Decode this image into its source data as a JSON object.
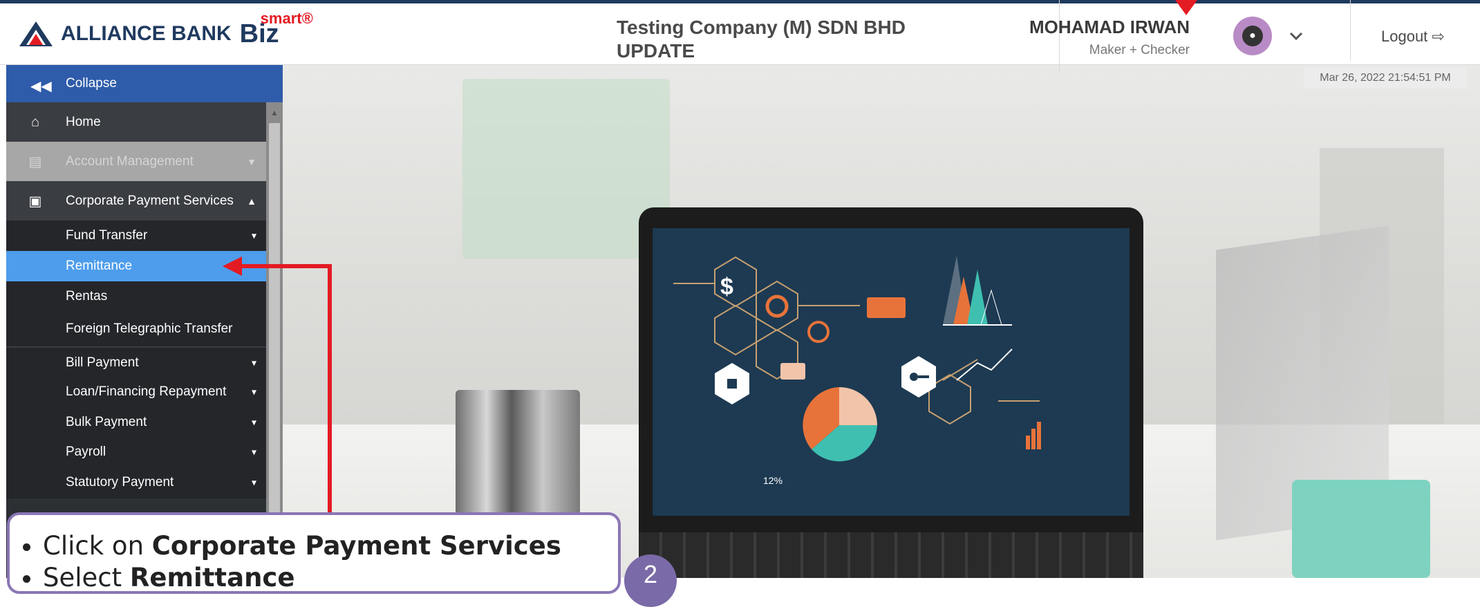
{
  "header": {
    "logo_text": "ALLIANCE BANK",
    "logo_biz": "Biz",
    "logo_smart": "smart®",
    "company_line1": "Testing Company (M) SDN BHD",
    "company_line2": "UPDATE",
    "user_name": "MOHAMAD IRWAN",
    "user_role": "Maker + Checker",
    "logout_label": "Logout ⇨"
  },
  "datetime": "Mar 26, 2022 21:54:51 PM",
  "sidebar": {
    "collapse_label": "Collapse",
    "items": [
      {
        "label": "Home",
        "icon": "home-icon"
      },
      {
        "label": "Account Management",
        "icon": "document-icon"
      },
      {
        "label": "Corporate Payment Services",
        "icon": "money-icon"
      },
      {
        "label": "Fund Transfer"
      },
      {
        "label": "Remittance"
      },
      {
        "label": "Rentas"
      },
      {
        "label": "Foreign Telegraphic Transfer"
      },
      {
        "label": "Bill Payment"
      },
      {
        "label": "Loan/Financing Repayment"
      },
      {
        "label": "Bulk Payment"
      },
      {
        "label": "Payroll"
      },
      {
        "label": "Statutory Payment"
      }
    ]
  },
  "callout": {
    "line1_prefix": "Click on ",
    "line1_bold": "Corporate Payment Services",
    "line2_prefix": "Select ",
    "line2_bold": "Remittance",
    "step_number": "2"
  },
  "colors": {
    "sidebar_bg": "#2c2f33",
    "collapse_bg": "#2f5caa",
    "active_bg": "#4d9dec",
    "annotation_red": "#e31b23",
    "callout_border": "#8a76b5"
  }
}
